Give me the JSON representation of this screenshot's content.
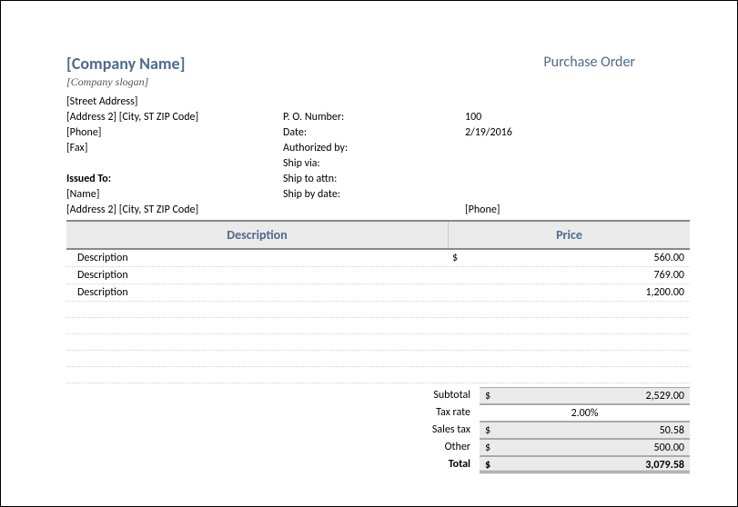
{
  "header": {
    "company_name": "[Company Name]",
    "po_title": "Purchase Order",
    "slogan": "[Company slogan]"
  },
  "address": {
    "street": "[Street Address]",
    "line2": "[Address 2] [City, ST ZIP Code]",
    "phone": "[Phone]",
    "fax": "[Fax]"
  },
  "po_info": {
    "po_number_label": "P. O. Number:",
    "po_number": "100",
    "date_label": "Date:",
    "date": "2/19/2016",
    "authorized_label": "Authorized by:",
    "authorized": "",
    "ship_via_label": "Ship via:",
    "ship_via": "",
    "ship_attn_label": "Ship to attn:",
    "ship_attn": "",
    "ship_by_label": "Ship by date:",
    "ship_by": ""
  },
  "issued": {
    "label": "Issued To:",
    "name": "[Name]",
    "address": "[Address 2] [City, ST ZIP Code]",
    "phone": "[Phone]"
  },
  "table": {
    "headers": {
      "description": "Description",
      "price": "Price"
    },
    "currency": "$",
    "rows": [
      {
        "desc": "Description",
        "price": "560.00"
      },
      {
        "desc": "Description",
        "price": "769.00"
      },
      {
        "desc": "Description",
        "price": "1,200.00"
      }
    ]
  },
  "totals": {
    "subtotal_label": "Subtotal",
    "subtotal": "2,529.00",
    "taxrate_label": "Tax rate",
    "taxrate": "2.00%",
    "salestax_label": "Sales tax",
    "salestax": "50.58",
    "other_label": "Other",
    "other": "500.00",
    "total_label": "Total",
    "total": "3,079.58",
    "currency": "$"
  }
}
